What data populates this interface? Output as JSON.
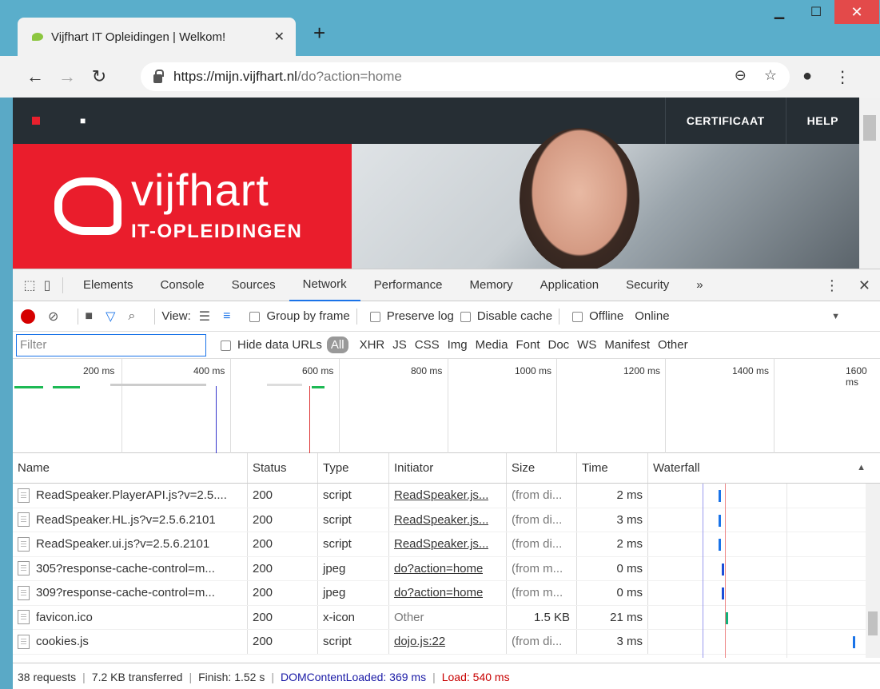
{
  "browser": {
    "tab_title": "Vijfhart IT Opleidingen | Welkom!",
    "tab_close": "✕",
    "new_tab": "+",
    "url_host": "https://mijn.vijfhart.nl",
    "url_path": "/do?action=home"
  },
  "site": {
    "nav_links": [
      "CERTIFICAAT",
      "HELP"
    ],
    "logo_name": "vijfhart",
    "logo_sub": "IT-OPLEIDINGEN"
  },
  "devtools": {
    "tabs": [
      "Elements",
      "Console",
      "Sources",
      "Network",
      "Performance",
      "Memory",
      "Application",
      "Security"
    ],
    "active_tab": "Network",
    "toolbar": {
      "view_label": "View:",
      "group_by_frame": "Group by frame",
      "preserve_log": "Preserve log",
      "disable_cache": "Disable cache",
      "offline": "Offline",
      "throttle_value": "Online"
    },
    "filter": {
      "placeholder": "Filter",
      "hide_data_urls": "Hide data URLs",
      "types": [
        "All",
        "XHR",
        "JS",
        "CSS",
        "Img",
        "Media",
        "Font",
        "Doc",
        "WS",
        "Manifest",
        "Other"
      ]
    },
    "overview_ticks": [
      "200 ms",
      "400 ms",
      "600 ms",
      "800 ms",
      "1000 ms",
      "1200 ms",
      "1400 ms",
      "1600 ms"
    ],
    "columns": [
      "Name",
      "Status",
      "Type",
      "Initiator",
      "Size",
      "Time",
      "Waterfall"
    ],
    "rows": [
      {
        "name": "ReadSpeaker.PlayerAPI.js?v=2.5....",
        "status": "200",
        "type": "script",
        "initiator": "ReadSpeaker.js...",
        "initiator_link": true,
        "size": "(from di...",
        "time": "2 ms"
      },
      {
        "name": "ReadSpeaker.HL.js?v=2.5.6.2101",
        "status": "200",
        "type": "script",
        "initiator": "ReadSpeaker.js...",
        "initiator_link": true,
        "size": "(from di...",
        "time": "3 ms"
      },
      {
        "name": "ReadSpeaker.ui.js?v=2.5.6.2101",
        "status": "200",
        "type": "script",
        "initiator": "ReadSpeaker.js...",
        "initiator_link": true,
        "size": "(from di...",
        "time": "2 ms"
      },
      {
        "name": "305?response-cache-control=m...",
        "status": "200",
        "type": "jpeg",
        "initiator": "do?action=home",
        "initiator_link": true,
        "size": "(from m...",
        "time": "0 ms"
      },
      {
        "name": "309?response-cache-control=m...",
        "status": "200",
        "type": "jpeg",
        "initiator": "do?action=home",
        "initiator_link": true,
        "size": "(from m...",
        "time": "0 ms"
      },
      {
        "name": "favicon.ico",
        "status": "200",
        "type": "x-icon",
        "initiator": "Other",
        "initiator_link": false,
        "size": "1.5 KB",
        "time": "21 ms"
      },
      {
        "name": "cookies.js",
        "status": "200",
        "type": "script",
        "initiator": "dojo.js:22",
        "initiator_link": true,
        "size": "(from di...",
        "time": "3 ms"
      }
    ],
    "status": {
      "requests": "38 requests",
      "transferred": "7.2 KB transferred",
      "finish": "Finish: 1.52 s",
      "dom_content_loaded": "DOMContentLoaded: 369 ms",
      "load": "Load: 540 ms"
    }
  },
  "colors": {
    "accent": "#1a73e8",
    "record": "#d50000",
    "brand_red": "#ea1d2c",
    "dom_line": "#3333cc",
    "load_line": "#dd3333"
  }
}
